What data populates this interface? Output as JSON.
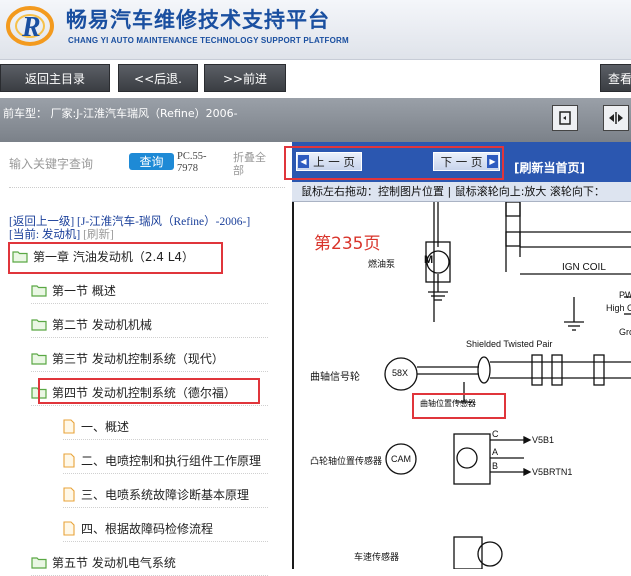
{
  "header": {
    "title": "畅易汽车维修技术支持平台",
    "subtitle": "CHANG YI AUTO MAINTENANCE TECHNOLOGY SUPPORT PLATFORM"
  },
  "nav": {
    "home": "返回主目录",
    "back": "<<后退.",
    "forward": ">>前进",
    "view": "查看"
  },
  "model_bar": {
    "text": "前车型：  厂家:J-江淮汽车瑞风（Refine）2006-"
  },
  "search": {
    "hint": "输入关键字查询",
    "button": "查询",
    "code_line1": "PC.55-",
    "code_line2": "7978",
    "collapse_line1": "折叠全",
    "collapse_line2": "部"
  },
  "breadcrumb": {
    "up": "[返回上一级]",
    "model": "[J-江淮汽车-瑞风（Refine）-2006-]",
    "current": "[当前: 发动机]",
    "refresh": "[刷新]"
  },
  "tree": [
    {
      "label": "第一章 汽油发动机（2.4 L4）",
      "type": "folder"
    },
    {
      "label": "第一节 概述",
      "type": "folder"
    },
    {
      "label": "第二节 发动机机械",
      "type": "folder"
    },
    {
      "label": "第三节 发动机控制系统（现代）",
      "type": "folder"
    },
    {
      "label": "第四节 发动机控制系统（德尔福）",
      "type": "folder"
    },
    {
      "label": "一、概述",
      "type": "file"
    },
    {
      "label": "二、电喷控制和执行组件工作原理",
      "type": "file"
    },
    {
      "label": "三、电喷系统故障诊断基本原理",
      "type": "file"
    },
    {
      "label": "四、根据故障码检修流程",
      "type": "file"
    },
    {
      "label": "第五节 发动机电气系统",
      "type": "folder"
    }
  ],
  "pager": {
    "prev": "上 一 页",
    "next": "下 一 页",
    "refresh_first": "[刷新当首页]",
    "hint": "鼠标左右拖动：控制图片位置 | 鼠标滚轮向上:放大   滚轮向下："
  },
  "diagram": {
    "page_label": "第235页",
    "labels": {
      "fuel_pump": "燃油泵",
      "ign_coil": "IGN COIL",
      "pwr": "PWR",
      "high_c": "High C",
      "grou": "Grou",
      "shielded": "Shielded Twisted Pair",
      "crank_wheel": "曲轴信号轮",
      "58x": "58X",
      "crank_sensor": "曲轴位置传感器",
      "cam_sensor": "凸轮轴位置传感器",
      "cam": "CAM",
      "v5b1": "V5B1",
      "v5brtn1": "V5BRTN1",
      "pin_c": "C",
      "pin_a": "A",
      "pin_b": "B",
      "speed_sensor": "车速传感器",
      "motor": "M"
    }
  },
  "colors": {
    "accent_blue": "#2b57b0",
    "highlight_red": "#e0353b",
    "page_label_red": "#d9342b"
  }
}
